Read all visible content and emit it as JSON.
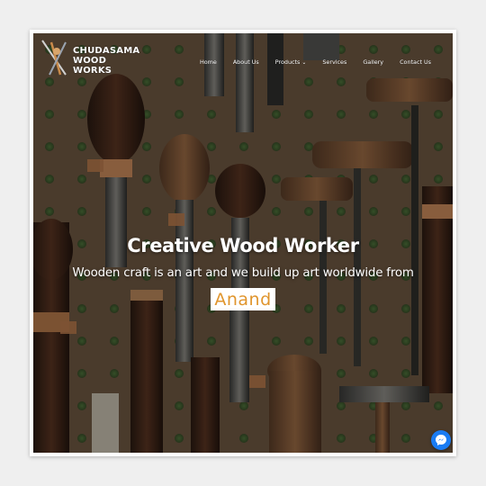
{
  "brand": {
    "line1": "CHUDASAMA",
    "line2": "WOOD WORKS"
  },
  "nav": {
    "items": [
      {
        "label": "Home"
      },
      {
        "label": "About Us"
      },
      {
        "label": "Products"
      },
      {
        "label": "Services"
      },
      {
        "label": "Gallery"
      },
      {
        "label": "Contact Us"
      }
    ],
    "products_dropdown_icon": "chevron-down-icon",
    "search_icon": "search-icon"
  },
  "hero": {
    "title": "Creative Wood Worker",
    "subtitle": "Wooden craft is an art and we build up art worldwide from",
    "highlight": "Anand"
  },
  "chat": {
    "icon": "messenger-icon",
    "color": "#1a7cf3"
  },
  "colors": {
    "highlight_text": "#e0952d",
    "pegboard": "#6a5440"
  }
}
